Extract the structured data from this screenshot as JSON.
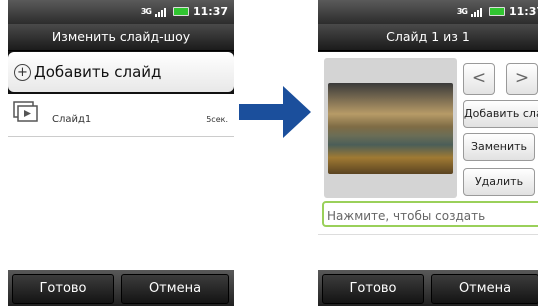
{
  "status": {
    "network": "3G",
    "time": "11:37",
    "status_color": "#31c531"
  },
  "left": {
    "title": "Изменить слайд-шоу",
    "add_slide_label": "Добавить слайд",
    "slides": [
      {
        "name": "Слайд1",
        "duration": "5сек."
      }
    ],
    "done_label": "Готово",
    "cancel_label": "Отмена"
  },
  "right": {
    "title": "Слайд 1 из 1",
    "prev_label": "<",
    "next_label": ">",
    "add_label": "Добавить слайд",
    "replace_label": "Заменить",
    "delete_label": "Удалить",
    "caption_placeholder": "Нажмите, чтобы создать",
    "done_label": "Готово",
    "cancel_label": "Отмена"
  },
  "colors": {
    "arrow": "#1b4f9c",
    "caption_border": "#9ad05a"
  },
  "icons": {
    "transition": "right-arrow-icon",
    "add": "plus-circle-icon",
    "slide": "slideshow-icon"
  }
}
